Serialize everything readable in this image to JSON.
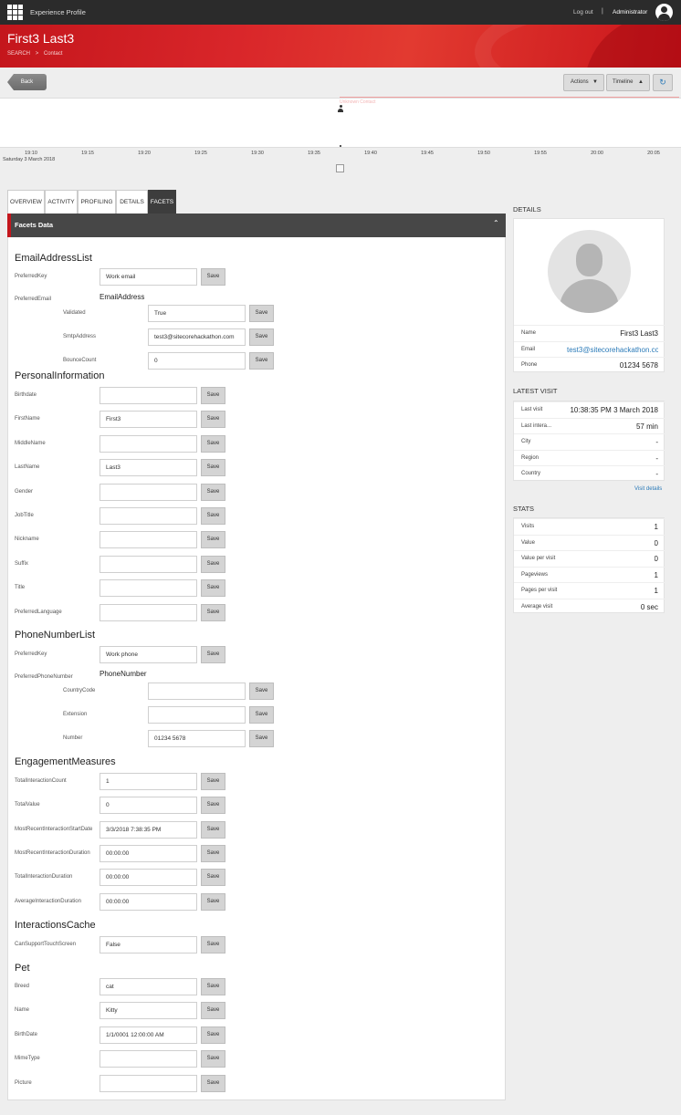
{
  "topbar": {
    "app_title": "Experience Profile",
    "logout": "Log out",
    "separator": "|",
    "user": "Administrator"
  },
  "header": {
    "title": "First3 Last3",
    "breadcrumb": [
      "SEARCH",
      ">",
      "Contact"
    ]
  },
  "toolbar": {
    "back": "Back",
    "actions": "Actions",
    "timeline": "Timeline"
  },
  "timeline": {
    "event_label": "Unknown Contact",
    "ticks": [
      "19:10",
      "19:15",
      "19:20",
      "19:25",
      "19:30",
      "19:35",
      "19:40",
      "19:45",
      "19:50",
      "19:55",
      "20:00",
      "20:05"
    ],
    "date": "Saturday 3 March 2018"
  },
  "tabs": [
    "OVERVIEW",
    "ACTIVITY",
    "PROFILING",
    "DETAILS",
    "FACETS"
  ],
  "facets": {
    "panel_title": "Facets Data",
    "save": "Save",
    "email": {
      "title": "EmailAddressList",
      "preferred_key_label": "PreferredKey",
      "preferred_key": "Work email",
      "preferred_email_label": "PreferredEmail",
      "sub": "EmailAddress",
      "validated_label": "Validated",
      "validated": "True",
      "smtp_label": "SmtpAddress",
      "smtp": "test3@sitecorehackathon.com",
      "bounce_label": "BounceCount",
      "bounce": "0"
    },
    "personal": {
      "title": "PersonalInformation",
      "fields": [
        {
          "label": "Birthdate",
          "value": ""
        },
        {
          "label": "FirstName",
          "value": "First3"
        },
        {
          "label": "MiddleName",
          "value": ""
        },
        {
          "label": "LastName",
          "value": "Last3"
        },
        {
          "label": "Gender",
          "value": ""
        },
        {
          "label": "JobTitle",
          "value": ""
        },
        {
          "label": "Nickname",
          "value": ""
        },
        {
          "label": "Suffix",
          "value": ""
        },
        {
          "label": "Title",
          "value": ""
        },
        {
          "label": "PreferredLanguage",
          "value": ""
        }
      ]
    },
    "phone": {
      "title": "PhoneNumberList",
      "preferred_key_label": "PreferredKey",
      "preferred_key": "Work phone",
      "preferred_phone_label": "PreferredPhoneNumber",
      "sub": "PhoneNumber",
      "country_label": "CountryCode",
      "country": "",
      "ext_label": "Extension",
      "ext": "",
      "number_label": "Number",
      "number": "01234 5678"
    },
    "engagement": {
      "title": "EngagementMeasures",
      "fields": [
        {
          "label": "TotalInteractionCount",
          "value": "1"
        },
        {
          "label": "TotalValue",
          "value": "0"
        },
        {
          "label": "MostRecentInteractionStartDate",
          "value": "3/3/2018 7:38:35 PM"
        },
        {
          "label": "MostRecentInteractionDuration",
          "value": "00:00:00"
        },
        {
          "label": "TotalInteractionDuration",
          "value": "00:00:00"
        },
        {
          "label": "AverageInteractionDuration",
          "value": "00:00:00"
        }
      ]
    },
    "cache": {
      "title": "InteractionsCache",
      "fields": [
        {
          "label": "CanSupportTouchScreen",
          "value": "False"
        }
      ]
    },
    "pet": {
      "title": "Pet",
      "fields": [
        {
          "label": "Breed",
          "value": "cat"
        },
        {
          "label": "Name",
          "value": "Kitty"
        },
        {
          "label": "BirthDate",
          "value": "1/1/0001 12:00:00 AM"
        },
        {
          "label": "MimeType",
          "value": ""
        },
        {
          "label": "Picture",
          "value": ""
        }
      ]
    }
  },
  "details": {
    "title": "DETAILS",
    "rows": [
      {
        "k": "Name",
        "v": "First3 Last3"
      },
      {
        "k": "Email",
        "v": "test3@sitecorehackathon.com"
      },
      {
        "k": "Phone",
        "v": "01234 5678"
      }
    ]
  },
  "latest_visit": {
    "title": "LATEST VISIT",
    "rows": [
      {
        "k": "Last visit",
        "v": "10:38:35 PM 3 March 2018"
      },
      {
        "k": "Last intera...",
        "v": "57 min"
      },
      {
        "k": "City",
        "v": "-"
      },
      {
        "k": "Region",
        "v": "-"
      },
      {
        "k": "Country",
        "v": "-"
      }
    ],
    "link": "Visit details"
  },
  "stats": {
    "title": "STATS",
    "rows": [
      {
        "k": "Visits",
        "v": "1"
      },
      {
        "k": "Value",
        "v": "0"
      },
      {
        "k": "Value per visit",
        "v": "0"
      },
      {
        "k": "Pageviews",
        "v": "1"
      },
      {
        "k": "Pages per visit",
        "v": "1"
      },
      {
        "k": "Average visit",
        "v": "0 sec"
      }
    ]
  },
  "colors": {
    "brand_red": "#c4161c",
    "dark": "#2b2b2b",
    "link": "#2a7ab8"
  }
}
